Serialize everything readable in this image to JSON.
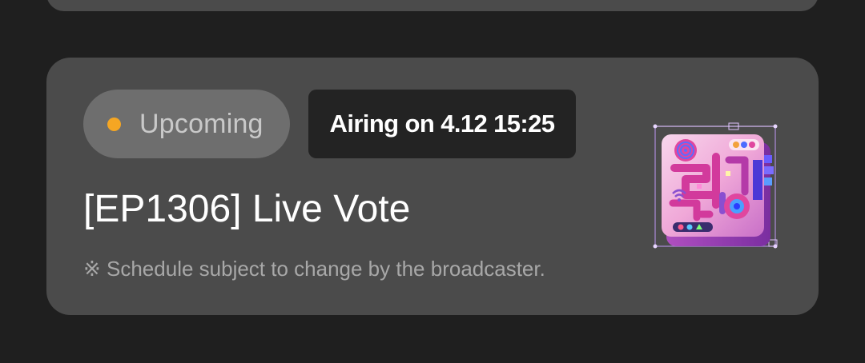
{
  "card": {
    "status": {
      "label": "Upcoming",
      "dot_color": "#f5a623"
    },
    "airing": {
      "label": "Airing on 4.12 15:25"
    },
    "title": "[EP1306] Live Vote",
    "note": "※ Schedule subject to change by the broadcaster.",
    "thumbnail": {
      "icon": "show-logo-3d-icon"
    }
  },
  "colors": {
    "page_background": "#1f1f1f",
    "card_background": "#4b4b4b",
    "pill_background": "#6e6e6e",
    "badge_background": "#232323",
    "accent_pink": "#e94bb5",
    "accent_purple": "#8b5cf6"
  }
}
